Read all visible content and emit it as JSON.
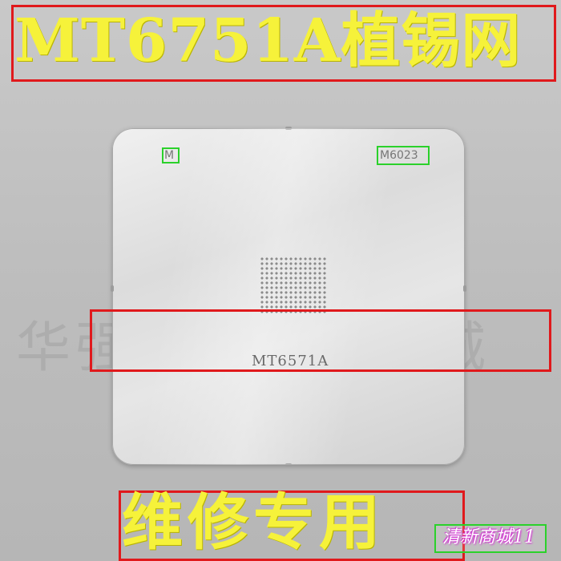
{
  "title": {
    "text": "MT6751A植锡网"
  },
  "watermark": {
    "text": "华强北泰兴配件城"
  },
  "stencil": {
    "corner_mark_left": "M",
    "corner_mark_right": "M6023",
    "model_label": "MT6571A"
  },
  "caption": {
    "text": "维修专用"
  },
  "shop": {
    "text": "清新商城11"
  },
  "colors": {
    "title_yellow": "#f6f23a",
    "box_red": "#e0191c",
    "box_green": "#2bd12b"
  }
}
